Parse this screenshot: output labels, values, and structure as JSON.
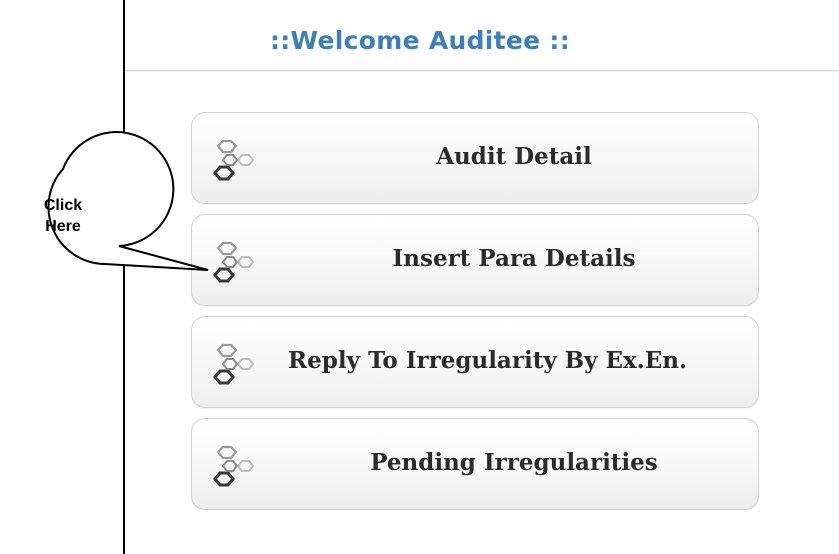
{
  "panel": {
    "title": "::Welcome Auditee ::"
  },
  "menu": [
    {
      "label": "Audit Detail",
      "icon": "hexagon-cluster-icon"
    },
    {
      "label": "Insert Para Details",
      "icon": "hexagon-cluster-icon"
    },
    {
      "label": "Reply To Irregularity By Ex.En.",
      "icon": "hexagon-cluster-icon"
    },
    {
      "label": "Pending Irregularities",
      "icon": "hexagon-cluster-icon"
    }
  ],
  "callout": {
    "line1": "Click",
    "line2": "Here"
  },
  "colors": {
    "title": "#3f7fb6",
    "button_text": "#2b2b2b",
    "button_border": "#d2d2d2"
  }
}
